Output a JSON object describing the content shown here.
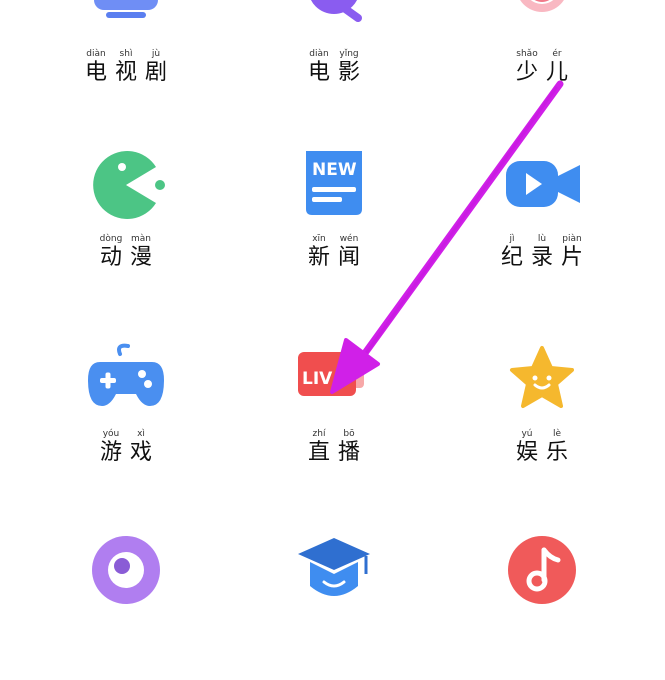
{
  "categories": [
    {
      "id": "tv",
      "pinyin": [
        "diàn",
        "shì",
        "jù"
      ],
      "hanzi": [
        "电",
        "视",
        "剧"
      ],
      "icon": "tv-icon",
      "color": "#5b7ff0"
    },
    {
      "id": "movie",
      "pinyin": [
        "diàn",
        "yǐng"
      ],
      "hanzi": [
        "电",
        "影"
      ],
      "icon": "film-reel-icon",
      "color": "#8a5cf0"
    },
    {
      "id": "kids",
      "pinyin": [
        "shǎo",
        "ér"
      ],
      "hanzi": [
        "少",
        "儿"
      ],
      "icon": "kids-face-icon",
      "color": "#f07a8a"
    },
    {
      "id": "anime",
      "pinyin": [
        "dòng",
        "màn"
      ],
      "hanzi": [
        "动",
        "漫"
      ],
      "icon": "pacman-icon",
      "color": "#4cc585"
    },
    {
      "id": "news",
      "pinyin": [
        "xīn",
        "wén"
      ],
      "hanzi": [
        "新",
        "闻"
      ],
      "icon": "newspaper-icon",
      "color": "#3f8df0",
      "badge": "NEW"
    },
    {
      "id": "documentary",
      "pinyin": [
        "jì",
        "lù",
        "piàn"
      ],
      "hanzi": [
        "纪",
        "录",
        "片"
      ],
      "icon": "video-camera-icon",
      "color": "#3f8df0"
    },
    {
      "id": "games",
      "pinyin": [
        "yóu",
        "xì"
      ],
      "hanzi": [
        "游",
        "戏"
      ],
      "icon": "gamepad-icon",
      "color": "#4a8ff0"
    },
    {
      "id": "live",
      "pinyin": [
        "zhí",
        "bō"
      ],
      "hanzi": [
        "直",
        "播"
      ],
      "icon": "live-icon",
      "color": "#f04e4e",
      "badge": "LIV"
    },
    {
      "id": "entertainment",
      "pinyin": [
        "yú",
        "lè"
      ],
      "hanzi": [
        "娱",
        "乐"
      ],
      "icon": "star-smile-icon",
      "color": "#f5b82e"
    },
    {
      "id": "circle",
      "pinyin": [],
      "hanzi": [],
      "icon": "eye-circle-icon",
      "color": "#b07ef0"
    },
    {
      "id": "education",
      "pinyin": [],
      "hanzi": [],
      "icon": "graduation-cap-icon",
      "color": "#3f8df0"
    },
    {
      "id": "music",
      "pinyin": [],
      "hanzi": [],
      "icon": "music-note-icon",
      "color": "#f05a5a"
    }
  ],
  "annotation": {
    "color": "#d020e8"
  }
}
